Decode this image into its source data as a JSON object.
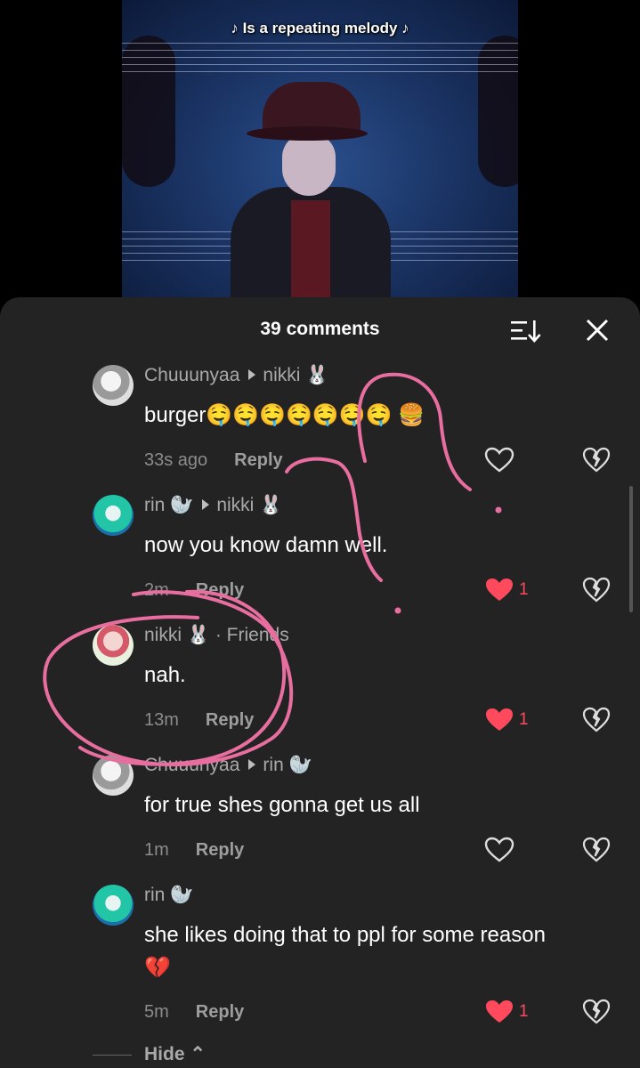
{
  "video": {
    "caption": "♪ Is a repeating melody ♪"
  },
  "header": {
    "title": "39 comments"
  },
  "icons": {
    "sort": "sort-icon",
    "close": "close-icon",
    "like": "heart-icon",
    "dislike": "broken-heart-icon"
  },
  "colors": {
    "panel_bg": "#232323",
    "like_red": "#ff4a5e",
    "scribble_pink": "#e86ea0"
  },
  "comments": [
    {
      "author": "Chuuunyaa",
      "reply_to": "nikki 🐰",
      "text": "burger🤤🤤🤤🤤🤤🤤🤤 🍔",
      "time": "33s ago",
      "reply": "Reply",
      "likes": "",
      "liked": false
    },
    {
      "author": "rin 🦭",
      "reply_to": "nikki 🐰",
      "text": "now you know damn well.",
      "time": "2m",
      "reply": "Reply",
      "likes": "1",
      "liked": true
    },
    {
      "author": "nikki 🐰",
      "tag": "· Friends",
      "text": "nah.",
      "time": "13m",
      "reply": "Reply",
      "likes": "1",
      "liked": true
    },
    {
      "author": "Chuuunyaa",
      "reply_to": "rin 🦭",
      "text": "for true shes gonna get us all",
      "time": "1m",
      "reply": "Reply",
      "likes": "",
      "liked": false
    },
    {
      "author": "rin 🦭",
      "reply_to": "",
      "text": "she likes doing that to ppl for some reason 💔",
      "time": "5m",
      "reply": "Reply",
      "likes": "1",
      "liked": true
    }
  ],
  "footer": {
    "hide_label": "Hide",
    "hide_chevron": "⌃"
  }
}
